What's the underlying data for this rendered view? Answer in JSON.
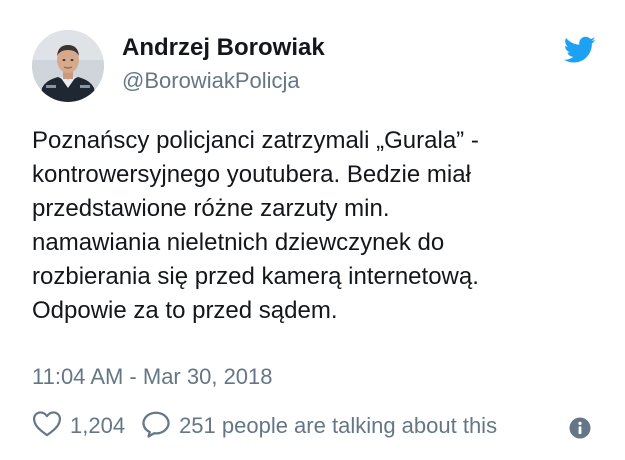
{
  "author": {
    "name": "Andrzej Borowiak",
    "handle": "@BorowiakPolicja"
  },
  "tweet": {
    "text": "Poznańscy policjanci zatrzymali „Gurala” -\nkontrowersyjnego youtubera. Bedzie miał\nprzedstawione różne zarzuty min.\nnamawiania nieletnich dziewczynek do\nrozbierania się przed kamerą internetową.\nOdpowie za to przed sądem.",
    "timestamp": "11:04 AM - Mar 30, 2018"
  },
  "actions": {
    "like_count": "1,204",
    "talking": "251 people are talking about this"
  },
  "icons": {
    "brand": "twitter-bird-icon",
    "like": "heart-icon",
    "reply": "speech-bubble-icon",
    "info": "info-icon"
  },
  "colors": {
    "brand": "#1da1f2",
    "text": "#14171a",
    "secondary": "#657786"
  }
}
